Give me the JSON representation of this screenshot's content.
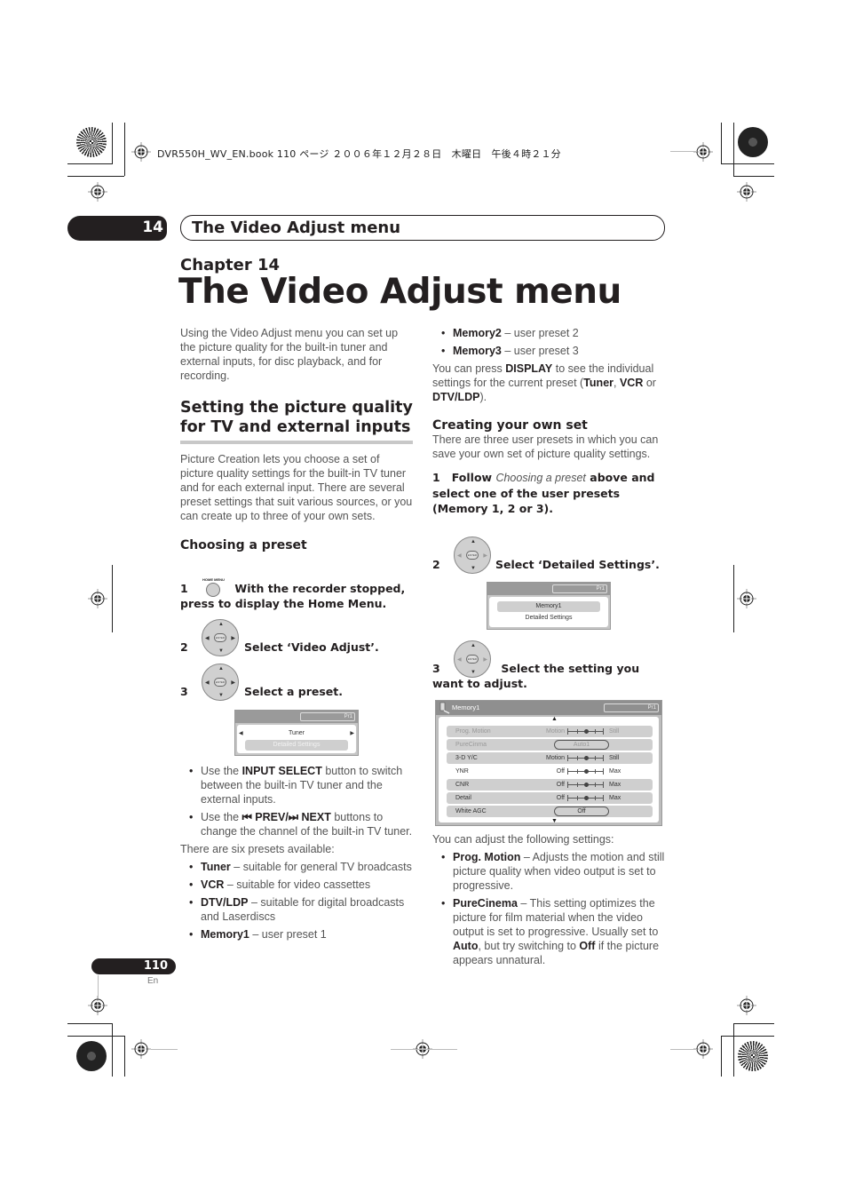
{
  "print_header": "DVR550H_WV_EN.book  110 ページ  ２００６年１２月２８日　木曜日　午後４時２１分",
  "chapter_tab": {
    "number": "14",
    "title": "The Video Adjust menu"
  },
  "chapter_label": "Chapter 14",
  "page_title": "The Video Adjust menu",
  "left_column": {
    "intro": "Using the Video Adjust menu you can set up the picture quality for the built-in tuner and external inputs, for disc playback, and for recording.",
    "section_heading": "Setting the picture quality for TV and external inputs",
    "section_body": "Picture Creation lets you choose a set of picture quality settings for the built-in TV tuner and for each external input. There are several preset settings that suit various sources, or you can create up to three of your own sets.",
    "subheading": "Choosing a preset",
    "steps": [
      {
        "num": "1",
        "button_label": "HOME MENU",
        "text": "With the recorder stopped, press to display the Home Menu."
      },
      {
        "num": "2",
        "text": "Select ‘Video Adjust’."
      },
      {
        "num": "3",
        "text": "Select a preset."
      }
    ],
    "osd_preset": {
      "pr": "Pr1",
      "selected": "Tuner",
      "option": "Detailed Settings"
    },
    "notes": [
      {
        "pre": "Use the ",
        "bold": "INPUT SELECT",
        "post": " button to switch between the built-in TV tuner and the external inputs."
      },
      {
        "pre": "Use the ",
        "bold": "⏮ PREV/⏭ NEXT",
        "post": " buttons to change the channel of the built-in TV tuner."
      }
    ],
    "presets_intro": "There are six presets available:",
    "presets": [
      {
        "name": "Tuner",
        "desc": " – suitable for general TV broadcasts"
      },
      {
        "name": "VCR",
        "desc": " – suitable for video cassettes"
      },
      {
        "name": "DTV/LDP",
        "desc": " – suitable for digital broadcasts and Laserdiscs"
      },
      {
        "name": "Memory1",
        "desc": " – user preset 1"
      }
    ]
  },
  "right_column": {
    "presets_cont": [
      {
        "name": "Memory2",
        "desc": " – user preset 2"
      },
      {
        "name": "Memory3",
        "desc": " – user preset 3"
      }
    ],
    "display_note": {
      "p1": "You can press ",
      "b1": "DISPLAY",
      "p2": " to see the individual settings for the current preset (",
      "b2": "Tuner",
      "p3": ", ",
      "b3": "VCR",
      "p4": " or ",
      "b4": "DTV/LDP",
      "p5": ")."
    },
    "subheading": "Creating your own set",
    "subheading_body": "There are three user presets in which you can save your own set of picture quality settings.",
    "step1": {
      "num": "1",
      "b1": "Follow ",
      "i": "Choosing a preset",
      "b2": " above and select one of the user presets (Memory 1, 2 or 3)."
    },
    "step2": {
      "num": "2",
      "text": "Select ‘Detailed Settings’."
    },
    "osd_memory": {
      "pr": "Pr1",
      "selected": "Memory1",
      "option": "Detailed Settings"
    },
    "step3": {
      "num": "3",
      "text": "Select the setting you want to adjust."
    },
    "osd_settings": {
      "title": "Memory1",
      "pr": "Pr1",
      "rows": [
        {
          "name": "Prog. Motion",
          "type": "slider",
          "lo": "Motion",
          "hi": "Still",
          "value": 0.5,
          "state": "dim"
        },
        {
          "name": "PureCinma",
          "type": "pill",
          "value": "Auto1",
          "state": "dim"
        },
        {
          "name": "3-D Y/C",
          "type": "slider",
          "lo": "Motion",
          "hi": "Still",
          "value": 0.5,
          "state": "normal"
        },
        {
          "name": "YNR",
          "type": "slider",
          "lo": "Off",
          "hi": "Max",
          "value": 0.5,
          "state": "selected"
        },
        {
          "name": "CNR",
          "type": "slider",
          "lo": "Off",
          "hi": "Max",
          "value": 0.5,
          "state": "normal"
        },
        {
          "name": "Detail",
          "type": "slider",
          "lo": "Off",
          "hi": "Max",
          "value": 0.5,
          "state": "normal"
        },
        {
          "name": "White AGC",
          "type": "pill",
          "value": "Off",
          "state": "normal"
        }
      ]
    },
    "adjust_intro": "You can adjust the following settings:",
    "adjust_items": [
      {
        "name": "Prog. Motion",
        "desc": " – Adjusts the motion and still picture quality when video output is set to progressive."
      },
      {
        "name": "PureCinema",
        "desc1": " – This setting optimizes the picture for film material when the video output is set to progressive. Usually set to ",
        "b1": "Auto",
        "desc2": ", but try switching to ",
        "b2": "Off",
        "desc3": " if the picture appears unnatural."
      }
    ]
  },
  "footer": {
    "page_number": "110",
    "language": "En"
  },
  "dpad_labels": {
    "enter": "ENTER"
  }
}
